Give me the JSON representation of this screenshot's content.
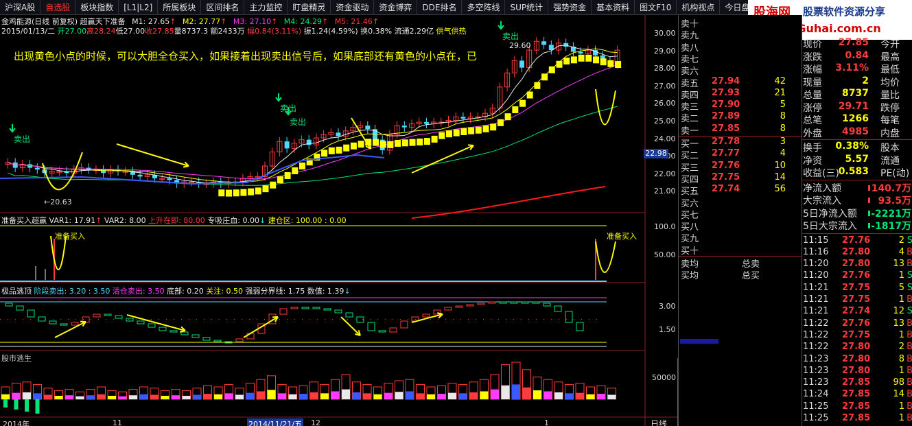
{
  "tabs": [
    "沪深A股",
    "自选股",
    "板块指数",
    "[L1|L2]",
    "所属板块",
    "区间排名",
    "主力监控",
    "盯盘精灵",
    "资金驱动",
    "资金博弈",
    "DDE排名",
    "多空阵线",
    "SUP统计",
    "强势资金",
    "基本资料",
    "图文F10",
    "机构视点",
    "今日盘前"
  ],
  "watermark": {
    "title": "股海网",
    "sub": "股票软件资源分享",
    "url": "www.Guhai.com.cn"
  },
  "main": {
    "title_line": "金鸡能源(日线 前复权)",
    "formula": "超赢天下准备",
    "ma": [
      {
        "label": "M1: 27.65",
        "arrow": "↑"
      },
      {
        "label": "M2: 27.77",
        "arrow": "↑"
      },
      {
        "label": "M3: 27.10",
        "arrow": "↑"
      },
      {
        "label": "M4: 24.29",
        "arrow": "↑"
      },
      {
        "label": "M5: 21.46",
        "arrow": "↑"
      }
    ],
    "ohlc_line": "2015/01/13/二",
    "open": "开27.00",
    "high": "高28.24",
    "low": "低27.00",
    "close": "收27.85",
    "vol": "量8737.3",
    "amount": "额2433万",
    "amp": "幅0.84(3.11%)",
    "swing": "振1.24(4.59%)",
    "turn": "换0.38%",
    "float": "流通2.29亿",
    "concept": "供气供热",
    "annotation": "出现黄色小点的时候，可以大胆全仓买入，如果接着出现卖出信号后，如果底部还有黄色的小点在，已",
    "sell_label": "卖出",
    "low_mark": "20.63",
    "high_mark": "29.60",
    "yaxis": [
      "30.00",
      "29.00",
      "28.00",
      "27.00",
      "26.00",
      "25.00",
      "24.00",
      "23.00",
      "22.00",
      "21.00"
    ],
    "current_price_tag": "22.98"
  },
  "panel2": {
    "title": "准备买入超赢",
    "var1": "VAR1: 17.91",
    "var2": "VAR2: 8.00",
    "up": "上升在即: 80.00",
    "zhuang": "专吸庄血: 0.00",
    "jiancang": "建仓区: 100.00 : 0.00",
    "buy_label": "准备买入",
    "yaxis": [
      "100.0",
      "50.00"
    ]
  },
  "panel3": {
    "title": "极品逃顶",
    "stage": "阶段卖出: 3.20 : 3.50",
    "clear": "清仓卖出: 3.50",
    "bottom": "底部: 0.20",
    "focus": "关注: 0.50",
    "line": "强弱分界线: 1.75",
    "value": "数值: 1.39",
    "yaxis": [
      "3.00",
      "1.50"
    ]
  },
  "panel4": {
    "title": "股市逃生",
    "yaxis": [
      "50000"
    ]
  },
  "xaxis": [
    "2014年",
    "11",
    "2014/11/21/五",
    "12",
    "1"
  ],
  "period_label": "日线",
  "orderbook": {
    "sells_empty": [
      "卖十",
      "卖九",
      "卖八",
      "卖七",
      "卖六"
    ],
    "sells": [
      {
        "l": "卖五",
        "p": "27.94",
        "v": "42"
      },
      {
        "l": "卖四",
        "p": "27.93",
        "v": "21"
      },
      {
        "l": "卖三",
        "p": "27.90",
        "v": "5"
      },
      {
        "l": "卖二",
        "p": "27.89",
        "v": "8"
      },
      {
        "l": "卖一",
        "p": "27.85",
        "v": "8"
      }
    ],
    "buys": [
      {
        "l": "买一",
        "p": "27.78",
        "v": "3"
      },
      {
        "l": "买二",
        "p": "27.77",
        "v": "4"
      },
      {
        "l": "买三",
        "p": "27.76",
        "v": "10"
      },
      {
        "l": "买四",
        "p": "27.75",
        "v": "14"
      },
      {
        "l": "买五",
        "p": "27.74",
        "v": "56"
      }
    ],
    "buys_empty": [
      "买六",
      "买七",
      "买八",
      "买九",
      "买十"
    ],
    "avg": [
      {
        "l": "卖均",
        "r": "总卖"
      },
      {
        "l": "买均",
        "r": "总买"
      }
    ]
  },
  "quote": {
    "rows": [
      {
        "k": "现价",
        "v": "27.85",
        "k2": "今开"
      },
      {
        "k": "涨跌",
        "v": "0.84",
        "k2": "最高"
      },
      {
        "k": "涨幅",
        "v": "3.11%",
        "k2": "最低"
      },
      {
        "k": "现量",
        "v": "2",
        "k2": "均价"
      },
      {
        "k": "总量",
        "v": "8737",
        "k2": "量比"
      },
      {
        "k": "涨停",
        "v": "29.71",
        "k2": "跌停"
      },
      {
        "k": "总笔",
        "v": "1266",
        "k2": "每笔"
      },
      {
        "k": "外盘",
        "v": "4985",
        "k2": "内盘"
      }
    ],
    "rows2": [
      {
        "k": "换手",
        "v": "0.38%",
        "k2": "股本"
      },
      {
        "k": "净资",
        "v": "5.57",
        "k2": "流通"
      },
      {
        "k": "收益(三)",
        "v": "0.583",
        "k2": "PE(动)"
      }
    ],
    "flows": [
      {
        "k": "净流入额",
        "v": "140.7万"
      },
      {
        "k": "大宗流入",
        "v": "93.5万"
      },
      {
        "k": "5日净流入额",
        "v": "-2221万"
      },
      {
        "k": "5日大宗流入",
        "v": "-1817万"
      }
    ],
    "ticks": [
      {
        "t": "11:15",
        "p": "27.76",
        "v": "2",
        "b": "S"
      },
      {
        "t": "11:16",
        "p": "27.80",
        "v": "4",
        "b": "B"
      },
      {
        "t": "11:20",
        "p": "27.80",
        "v": "13",
        "b": "B"
      },
      {
        "t": "11:20",
        "p": "27.76",
        "v": "1",
        "b": "S"
      },
      {
        "t": "11:21",
        "p": "27.75",
        "v": "5",
        "b": "S"
      },
      {
        "t": "11:21",
        "p": "27.75",
        "v": "1",
        "b": "B"
      },
      {
        "t": "11:21",
        "p": "27.74",
        "v": "12",
        "b": "S"
      },
      {
        "t": "11:22",
        "p": "27.76",
        "v": "13",
        "b": "B"
      },
      {
        "t": "11:22",
        "p": "27.75",
        "v": "1",
        "b": "B"
      },
      {
        "t": "11:22",
        "p": "27.80",
        "v": "2",
        "b": "B"
      },
      {
        "t": "11:23",
        "p": "27.80",
        "v": "8",
        "b": "B"
      },
      {
        "t": "11:23",
        "p": "27.80",
        "v": "1",
        "b": "B"
      },
      {
        "t": "11:23",
        "p": "27.85",
        "v": "98",
        "b": "B"
      },
      {
        "t": "11:24",
        "p": "27.85",
        "v": "14",
        "b": "B"
      },
      {
        "t": "11:25",
        "p": "27.85",
        "v": "1",
        "b": "B"
      },
      {
        "t": "11:25",
        "p": "27.85",
        "v": "1",
        "b": "B"
      }
    ]
  }
}
